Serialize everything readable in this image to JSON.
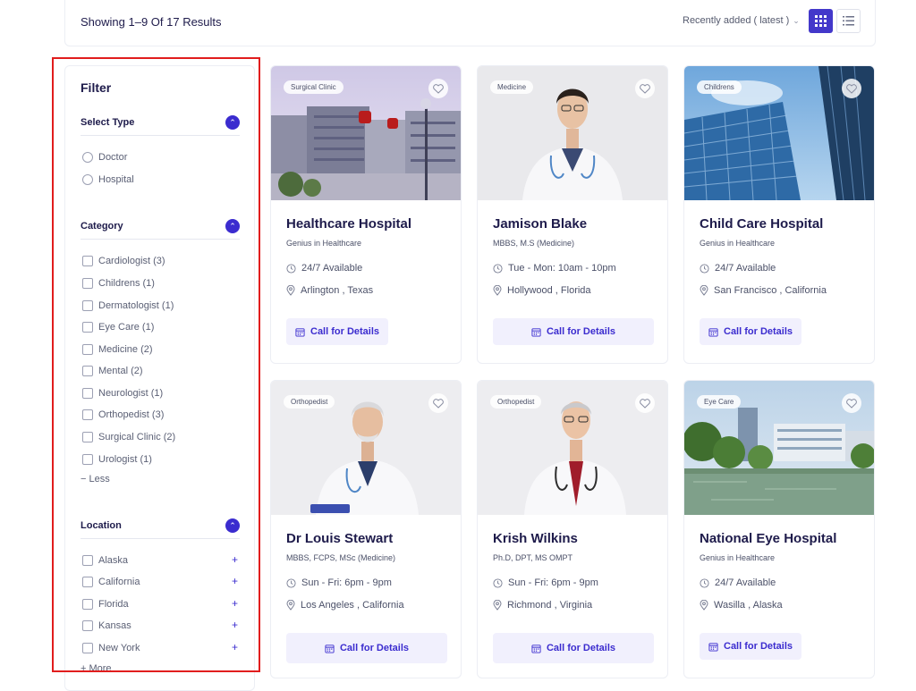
{
  "results": {
    "text": "Showing 1–9 Of 17 Results",
    "sort_label": "Recently added ( latest )",
    "views": [
      "grid-icon",
      "list-icon"
    ]
  },
  "filter": {
    "title": "Filter",
    "sections": {
      "type": {
        "label": "Select Type",
        "options": [
          "Doctor",
          "Hospital"
        ]
      },
      "category": {
        "label": "Category",
        "options": [
          "Cardiologist (3)",
          "Childrens (1)",
          "Dermatologist (1)",
          "Eye Care (1)",
          "Medicine (2)",
          "Mental (2)",
          "Neurologist (1)",
          "Orthopedist (3)",
          "Surgical Clinic (2)",
          "Urologist (1)"
        ],
        "less_label": "− Less"
      },
      "location": {
        "label": "Location",
        "options": [
          "Alaska",
          "California",
          "Florida",
          "Kansas",
          "New York"
        ],
        "more_label": "+ More"
      }
    }
  },
  "cards": [
    {
      "tag": "Surgical Clinic",
      "name": "Healthcare Hospital",
      "sub": "Genius in Healthcare",
      "hours": "24/7 Available",
      "location": "Arlington , Texas",
      "cta": "Call for Details"
    },
    {
      "tag": "Medicine",
      "name": "Jamison Blake",
      "sub": "MBBS, M.S (Medicine)",
      "hours": "Tue - Mon: 10am - 10pm",
      "location": "Hollywood , Florida",
      "cta": "Call for Details"
    },
    {
      "tag": "Childrens",
      "name": "Child Care Hospital",
      "sub": "Genius in Healthcare",
      "hours": "24/7 Available",
      "location": "San Francisco , California",
      "cta": "Call for Details"
    },
    {
      "tag": "Orthopedist",
      "name": "Dr Louis Stewart",
      "sub": "MBBS, FCPS, MSc (Medicine)",
      "hours": "Sun - Fri: 6pm - 9pm",
      "location": "Los Angeles , California",
      "cta": "Call for Details"
    },
    {
      "tag": "Orthopedist",
      "name": "Krish Wilkins",
      "sub": "Ph.D, DPT, MS OMPT",
      "hours": "Sun - Fri: 6pm - 9pm",
      "location": "Richmond , Virginia",
      "cta": "Call for Details"
    },
    {
      "tag": "Eye Care",
      "name": "National Eye Hospital",
      "sub": "Genius in Healthcare",
      "hours": "24/7 Available",
      "location": "Wasilla , Alaska",
      "cta": "Call for Details"
    }
  ],
  "colors": {
    "accent": "#4338ca",
    "highlight": "#e11d1d",
    "text": "#1e1b4b"
  }
}
